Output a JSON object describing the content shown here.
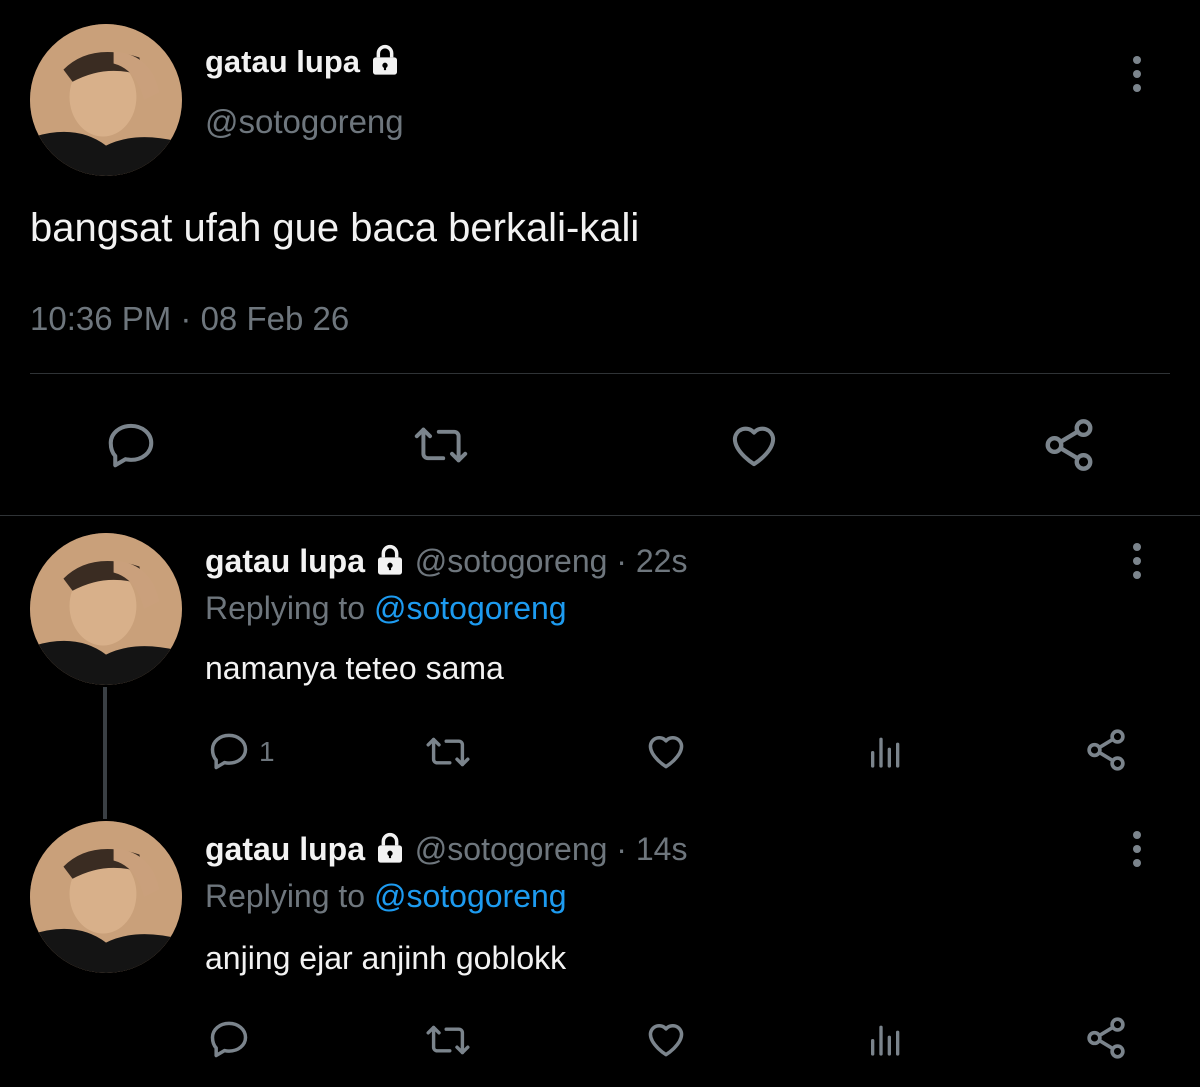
{
  "main_tweet": {
    "display_name": "gatau lupa",
    "handle": "@sotogoreng",
    "text": "bangsat ufah gue baca berkali-kali",
    "timestamp": "10:36 PM · 08 Feb 26"
  },
  "replies": [
    {
      "display_name": "gatau lupa",
      "handle": "@sotogoreng",
      "age": "· 22s",
      "replying_prefix": "Replying to",
      "replying_handle": "@sotogoreng",
      "text": "namanya teteo sama",
      "reply_count": "1"
    },
    {
      "display_name": "gatau lupa",
      "handle": "@sotogoreng",
      "age": "· 14s",
      "replying_prefix": "Replying to",
      "replying_handle": "@sotogoreng",
      "text": "anjing ejar anjinh goblokk",
      "reply_count": ""
    }
  ],
  "icons": [
    "lock-icon",
    "more-icon",
    "reply-icon",
    "retweet-icon",
    "like-icon",
    "views-icon",
    "share-icon"
  ],
  "colors": {
    "background": "#000000",
    "muted": "#6e767d",
    "link": "#1d9bf0",
    "icon": "#7b848c"
  }
}
